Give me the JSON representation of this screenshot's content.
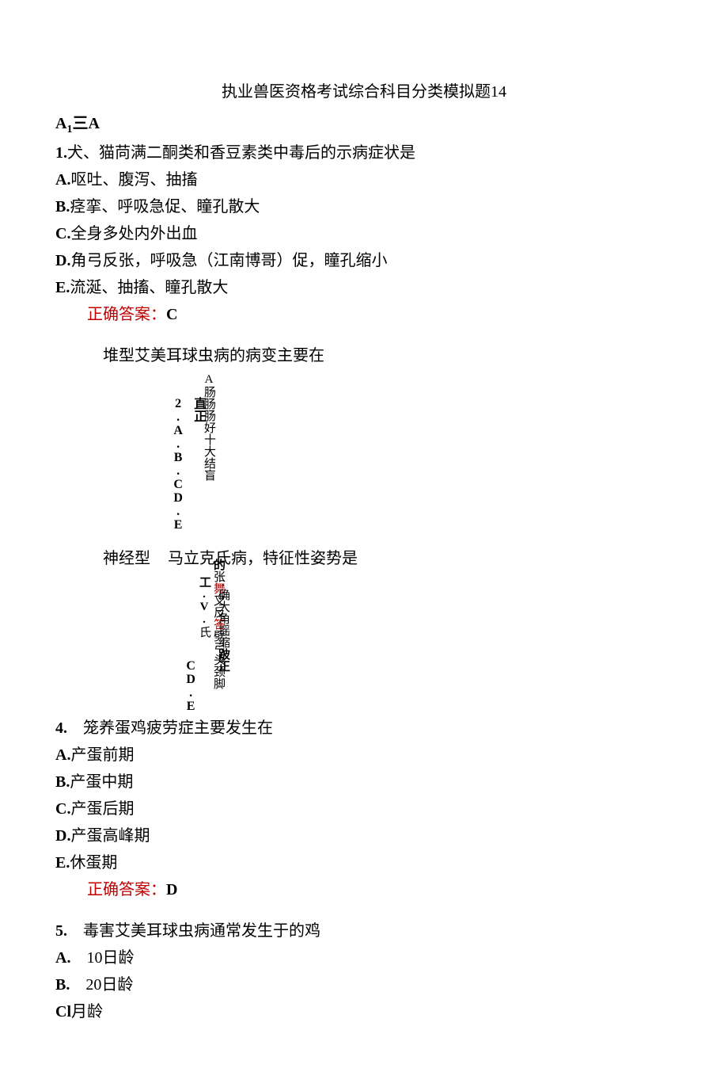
{
  "title": "执业兽医资格考试综合科目分类模拟题14",
  "section_label_prefix": "A",
  "section_label_sub": "1",
  "section_label_suffix": "三A",
  "q1": {
    "num": "1.",
    "stem": "犬、猫苘满二酮类和香豆素类中毒后的示病症状是",
    "A": "呕吐、腹泻、抽搐",
    "B": "痉挛、呼吸急促、瞳孔散大",
    "C": "全身多处内外出血",
    "D": "角弓反张，呼吸急（江南博哥）促，瞳孔缩小",
    "E": "流涎、抽搐、瞳孔散大",
    "answer_label": "正确答案：",
    "answer_letter": "C"
  },
  "q2": {
    "stem": "堆型艾美耳球虫病的病变主要在",
    "vcol1": "A肠肠肠好十大结盲",
    "vcol2": "直正2.A.B.CD.E"
  },
  "q3": {
    "stem_left": "神经型",
    "stem_right": "马立克氏病，特征性姿势是",
    "vcol1_a": "的",
    "vcol1_b": "张",
    "vcol1_c": "舞",
    "vcol1_d": "叉反",
    "vcol1_e": "答",
    "vcol1_f": "劈弓头颈脚",
    "vcol2_a": ":确大角摇缩",
    "vcol2_b": "跛正工.V.",
    "vcol2_c": "氏",
    "vcol3": "CD.E."
  },
  "q4": {
    "num": "4.",
    "stem": "笼养蛋鸡疲劳症主要发生在",
    "A": "产蛋前期",
    "B": "产蛋中期",
    "C": "产蛋后期",
    "D": "产蛋高峰期",
    "E": "休蛋期",
    "answer_label": "正确答案：",
    "answer_letter": "D"
  },
  "q5": {
    "num": "5.",
    "stem": "毒害艾美耳球虫病通常发生于的鸡",
    "A": "10日龄",
    "B": "20日龄",
    "C_prefix": "Cl",
    "C_text": "月龄"
  }
}
